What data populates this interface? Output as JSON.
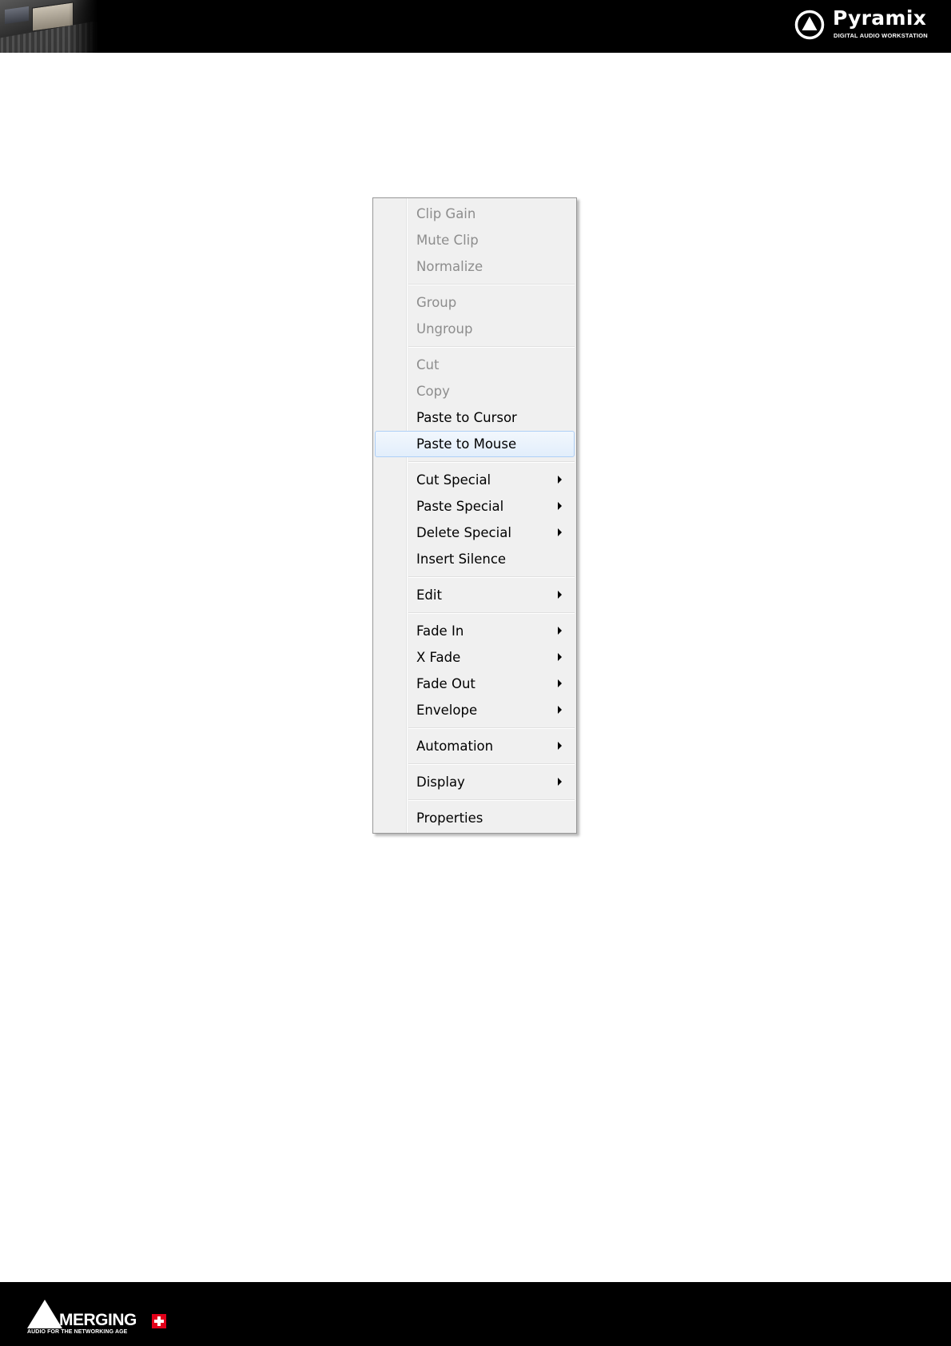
{
  "header": {
    "brand_name": "Pyramix",
    "brand_tagline": "DIGITAL AUDIO WORKSTATION",
    "brand_icon": "pyramix-triangle-icon"
  },
  "context_menu": {
    "groups": [
      [
        {
          "label": "Clip Gain",
          "disabled": true,
          "submenu": false
        },
        {
          "label": "Mute Clip",
          "disabled": true,
          "submenu": false
        },
        {
          "label": "Normalize",
          "disabled": true,
          "submenu": false
        }
      ],
      [
        {
          "label": "Group",
          "disabled": true,
          "submenu": false
        },
        {
          "label": "Ungroup",
          "disabled": true,
          "submenu": false
        }
      ],
      [
        {
          "label": "Cut",
          "disabled": true,
          "submenu": false
        },
        {
          "label": "Copy",
          "disabled": true,
          "submenu": false
        },
        {
          "label": "Paste to Cursor",
          "disabled": false,
          "submenu": false
        },
        {
          "label": "Paste to Mouse",
          "disabled": false,
          "submenu": false,
          "highlighted": true
        }
      ],
      [
        {
          "label": "Cut Special",
          "disabled": false,
          "submenu": true
        },
        {
          "label": "Paste Special",
          "disabled": false,
          "submenu": true
        },
        {
          "label": "Delete Special",
          "disabled": false,
          "submenu": true
        },
        {
          "label": "Insert Silence",
          "disabled": false,
          "submenu": false
        }
      ],
      [
        {
          "label": "Edit",
          "disabled": false,
          "submenu": true
        }
      ],
      [
        {
          "label": "Fade In",
          "disabled": false,
          "submenu": true
        },
        {
          "label": "X Fade",
          "disabled": false,
          "submenu": true
        },
        {
          "label": "Fade Out",
          "disabled": false,
          "submenu": true
        },
        {
          "label": "Envelope",
          "disabled": false,
          "submenu": true
        }
      ],
      [
        {
          "label": "Automation",
          "disabled": false,
          "submenu": true
        }
      ],
      [
        {
          "label": "Display",
          "disabled": false,
          "submenu": true
        }
      ],
      [
        {
          "label": "Properties",
          "disabled": false,
          "submenu": false
        }
      ]
    ],
    "submenu_icon": "chevron-right-icon"
  },
  "footer": {
    "logo_name": "MERGING",
    "logo_tagline": "AUDIO FOR THE NETWORKING AGE",
    "logo_icon": "merging-triangle-icon",
    "flag_icon": "swiss-cross-icon"
  },
  "colors": {
    "bar_background": "#000000",
    "menu_background": "#f0f0f0",
    "disabled_text": "#8d8d8d",
    "highlight_border": "#aecff7",
    "swiss_red": "#e2001a"
  }
}
